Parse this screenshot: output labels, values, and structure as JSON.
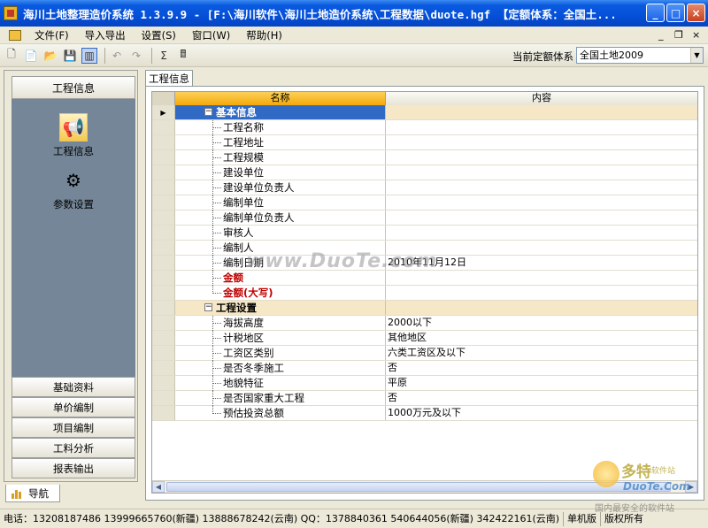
{
  "window": {
    "title": "海川土地整理造价系统 1.3.9.9 - [F:\\海川软件\\海川土地造价系统\\工程数据\\duote.hgf 【定额体系：全国土...",
    "minimize_label": "_",
    "maximize_label": "□",
    "close_label": "×"
  },
  "menu": {
    "items": [
      "文件(F)",
      "导入导出",
      "设置(S)",
      "窗口(W)",
      "帮助(H)"
    ],
    "mdi_minimize": "_",
    "mdi_restore": "❐",
    "mdi_close": "×"
  },
  "toolbar": {
    "norm_label": "当前定额体系",
    "norm_value": "全国土地2009",
    "sum_label": "Σ"
  },
  "leftnav": {
    "header": "工程信息",
    "icon_items": [
      {
        "label": "工程信息",
        "icon": "megaphone-icon"
      },
      {
        "label": "参数设置",
        "icon": "gear-icon"
      }
    ],
    "bottom_items": [
      "基础资料",
      "单价编制",
      "项目编制",
      "工料分析",
      "报表输出"
    ],
    "tab_label": "导航"
  },
  "main": {
    "tab_label": "工程信息",
    "columns": {
      "name": "名称",
      "content": "内容"
    },
    "groups": [
      {
        "label": "基本信息",
        "expander": "−",
        "rows": [
          {
            "name": "工程名称",
            "value": ""
          },
          {
            "name": "工程地址",
            "value": ""
          },
          {
            "name": "工程规模",
            "value": ""
          },
          {
            "name": "建设单位",
            "value": ""
          },
          {
            "name": "建设单位负责人",
            "value": ""
          },
          {
            "name": "编制单位",
            "value": ""
          },
          {
            "name": "编制单位负责人",
            "value": ""
          },
          {
            "name": "审核人",
            "value": ""
          },
          {
            "name": "编制人",
            "value": ""
          },
          {
            "name": "编制日期",
            "value": "2010年11月12日"
          },
          {
            "name": "金额",
            "value": "",
            "red": true
          },
          {
            "name": "金额(大写)",
            "value": "",
            "red": true
          }
        ]
      },
      {
        "label": "工程设置",
        "expander": "−",
        "rows": [
          {
            "name": "海拔高度",
            "value": "2000以下"
          },
          {
            "name": "计税地区",
            "value": "其他地区"
          },
          {
            "name": "工资区类别",
            "value": "六类工资区及以下"
          },
          {
            "name": "是否冬季施工",
            "value": "否"
          },
          {
            "name": "地貌特征",
            "value": "平原"
          },
          {
            "name": "是否国家重大工程",
            "value": "否"
          },
          {
            "name": "预估投资总额",
            "value": "1000万元及以下"
          }
        ]
      }
    ]
  },
  "watermark": "www.DuoTe.com",
  "corner_logo": {
    "main": "多特",
    "sub": "软件站",
    "domain": "DuoTe.Com",
    "tagline": "国内最安全的软件站"
  },
  "statusbar": {
    "phones": "电话：13208187486 13999665760(新疆) 13888678242(云南) QQ：1378840361 540644056(新疆) 342422161(云南)",
    "edition": "单机版",
    "copyright": "版权所有"
  },
  "colors": {
    "title_blue": "#0550d8",
    "nav_pane": "#748697",
    "group_row": "#f6e7c6",
    "header_orange": "#f5a90a",
    "red_text": "#c00000"
  }
}
